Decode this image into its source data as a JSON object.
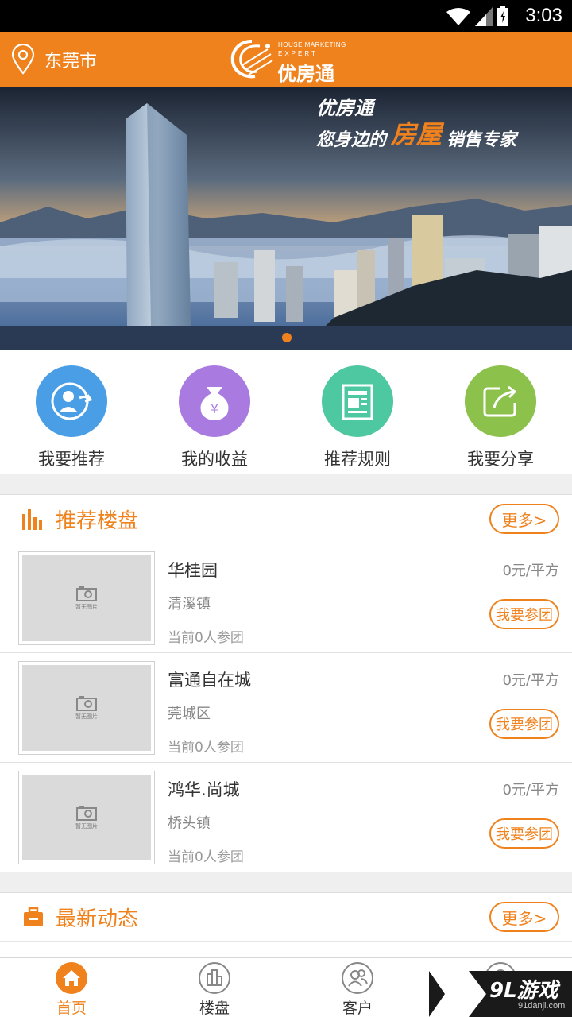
{
  "status_bar": {
    "time": "3:03"
  },
  "header": {
    "city": "东莞市",
    "logo_en_line1": "HOUSE MARKETING",
    "logo_en_line2": "EXPERT",
    "logo_cn": "优房通"
  },
  "banner": {
    "slogan_brand": "优房通",
    "slogan_prefix": "您身边的",
    "slogan_highlight": "房屋",
    "slogan_suffix": "销售专家",
    "active_slide": 1,
    "slide_count": 1
  },
  "quick_menu": [
    {
      "label": "我要推荐",
      "icon": "person-share-icon",
      "color": "#4a9ee6"
    },
    {
      "label": "我的收益",
      "icon": "money-bag-icon",
      "color": "#a97be0"
    },
    {
      "label": "推荐规则",
      "icon": "document-icon",
      "color": "#4dc8a0"
    },
    {
      "label": "我要分享",
      "icon": "share-icon",
      "color": "#8cc14c"
    }
  ],
  "recommended": {
    "title": "推荐楼盘",
    "more_label": "更多>",
    "join_label": "我要参团",
    "placeholder_text": "暂无图片",
    "items": [
      {
        "name": "华桂园",
        "area": "清溪镇",
        "group": "当前0人参团",
        "price": "0元/平方"
      },
      {
        "name": "富通自在城",
        "area": "莞城区",
        "group": "当前0人参团",
        "price": "0元/平方"
      },
      {
        "name": "鸿华.尚城",
        "area": "桥头镇",
        "group": "当前0人参团",
        "price": "0元/平方"
      }
    ]
  },
  "news": {
    "title": "最新动态",
    "more_label": "更多>"
  },
  "tabbar": {
    "tabs": [
      {
        "label": "首页",
        "icon": "home-icon",
        "active": true
      },
      {
        "label": "楼盘",
        "icon": "buildings-icon",
        "active": false
      },
      {
        "label": "客户",
        "icon": "customers-icon",
        "active": false
      },
      {
        "label": "",
        "icon": "profile-icon",
        "active": false
      }
    ]
  },
  "watermark": {
    "main": "9L游戏",
    "sub": "91danji.com"
  },
  "colors": {
    "accent": "#f0821e"
  }
}
